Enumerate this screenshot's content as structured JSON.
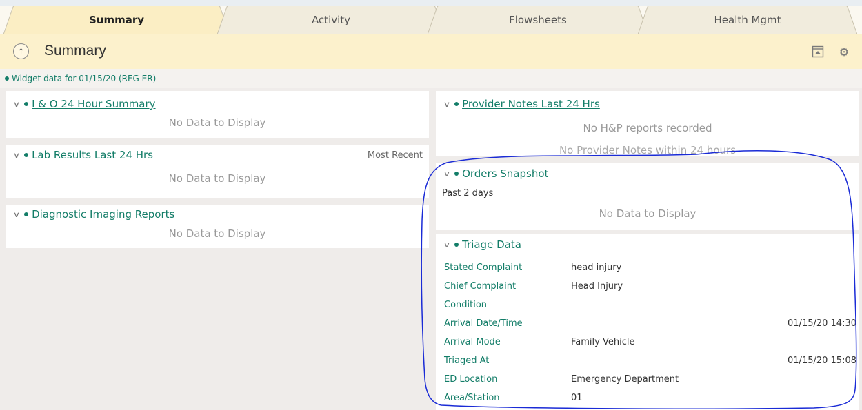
{
  "tabs": [
    {
      "label": "Summary",
      "active": true
    },
    {
      "label": "Activity",
      "active": false
    },
    {
      "label": "Flowsheets",
      "active": false
    },
    {
      "label": "Health Mgmt",
      "active": false
    }
  ],
  "header": {
    "title": "Summary",
    "icons": [
      "up-arrow-icon",
      "expand-panel-icon",
      "gear-icon"
    ]
  },
  "widget_bar": {
    "text": "Widget data for 01/15/20 (REG ER)"
  },
  "left": {
    "io": {
      "title": "I & O 24 Hour Summary",
      "empty": "No Data to Display"
    },
    "lab": {
      "title": "Lab Results Last 24 Hrs",
      "right_label": "Most Recent",
      "empty": "No Data to Display"
    },
    "imaging": {
      "title": "Diagnostic Imaging Reports",
      "empty": "No Data to Display"
    }
  },
  "right": {
    "provider_notes": {
      "title": "Provider Notes Last 24 Hrs",
      "line1": "No H&P reports recorded",
      "line2": "No Provider Notes within 24 hours"
    },
    "orders": {
      "title": "Orders Snapshot",
      "subtitle": "Past 2 days",
      "empty": "No Data to Display"
    },
    "triage": {
      "title": "Triage Data",
      "rows": [
        {
          "label": "Stated Complaint",
          "value": "head injury",
          "right": ""
        },
        {
          "label": "Chief Complaint",
          "value": "Head Injury",
          "right": ""
        },
        {
          "label": "Condition",
          "value": "",
          "right": ""
        },
        {
          "label": "Arrival Date/Time",
          "value": "",
          "right": "01/15/20 14:30"
        },
        {
          "label": "Arrival Mode",
          "value": "Family Vehicle",
          "right": ""
        },
        {
          "label": "Triaged At",
          "value": "",
          "right": "01/15/20 15:08"
        },
        {
          "label": "ED Location",
          "value": "Emergency Department",
          "right": ""
        },
        {
          "label": "Area/Station",
          "value": "01",
          "right": ""
        }
      ]
    }
  },
  "colors": {
    "accent_teal": "#137d68",
    "header_yellow": "#fcf1cc",
    "annotation_blue": "#1a2bd6"
  }
}
